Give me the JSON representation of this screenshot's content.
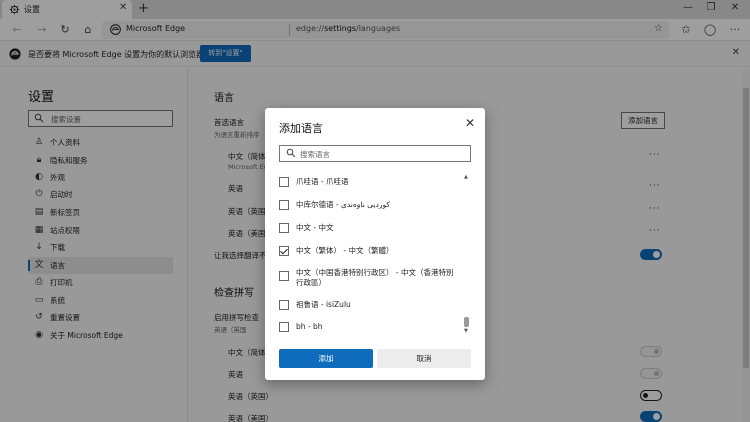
{
  "colors": {
    "accent": "#0f6cbd",
    "overlay": "rgba(0,0,0,0.38)"
  },
  "tab": {
    "title": "设置",
    "icon": "gear-icon"
  },
  "window": {
    "minimize_icon": "minimize-icon",
    "restore_icon": "restore-icon",
    "close_icon": "close-icon"
  },
  "omnibox": {
    "site": "Microsoft Edge",
    "url_prefix": "edge://",
    "url_bold": "settings",
    "url_suffix": "/languages"
  },
  "infobar": {
    "text": "是否要将 Microsoft Edge 设置为你的默认浏览器?",
    "button": "转到\"设置\""
  },
  "sidebar": {
    "title": "设置",
    "search_placeholder": "搜索设置",
    "items": [
      {
        "label": "个人资料",
        "icon": "person-icon"
      },
      {
        "label": "隐私和服务",
        "icon": "lock-icon"
      },
      {
        "label": "外观",
        "icon": "appearance-icon"
      },
      {
        "label": "启动时",
        "icon": "power-icon"
      },
      {
        "label": "新标签页",
        "icon": "newtab-icon"
      },
      {
        "label": "站点权限",
        "icon": "permissions-icon"
      },
      {
        "label": "下载",
        "icon": "download-icon"
      },
      {
        "label": "语言",
        "icon": "language-icon",
        "active": true
      },
      {
        "label": "打印机",
        "icon": "printer-icon"
      },
      {
        "label": "系统",
        "icon": "system-icon"
      },
      {
        "label": "重置设置",
        "icon": "reset-icon"
      },
      {
        "label": "关于 Microsoft Edge",
        "icon": "edge-logo-icon"
      }
    ]
  },
  "main": {
    "heading": "语言",
    "preferred_title": "首选语言",
    "preferred_sub": "为语言重新排序",
    "add_language_button": "添加语言",
    "languages": [
      {
        "label": "中文（简体",
        "sub": "Microsoft Ed"
      },
      {
        "label": "英语"
      },
      {
        "label": "英语（英国"
      },
      {
        "label": "英语（美国"
      }
    ],
    "offer_translate": "让我选择翻译不",
    "spellcheck_heading": "检查拼写",
    "spellcheck_title": "启用拼写检查",
    "spellcheck_sub": "英语（英国",
    "spell_languages": [
      "中文（简体",
      "英语",
      "英语（英国）",
      "英语（美国）"
    ],
    "more_icon": "···"
  },
  "dialog": {
    "title": "添加语言",
    "search_placeholder": "搜索语言",
    "items": [
      {
        "label": "爪哇语 - 爪哇语",
        "checked": false
      },
      {
        "label": "中库尔德语 - کوردیی ناوەندی",
        "checked": false
      },
      {
        "label": "中文 - 中文",
        "checked": false
      },
      {
        "label": "中文（繁体） - 中文（繁體）",
        "checked": true
      },
      {
        "label": "中文（中国香港特别行政区） - 中文（香港特別行政區）",
        "checked": false
      },
      {
        "label": "祖鲁语 - isiZulu",
        "checked": false
      },
      {
        "label": "bh - bh",
        "checked": false
      }
    ],
    "add_button": "添加",
    "cancel_button": "取消"
  }
}
